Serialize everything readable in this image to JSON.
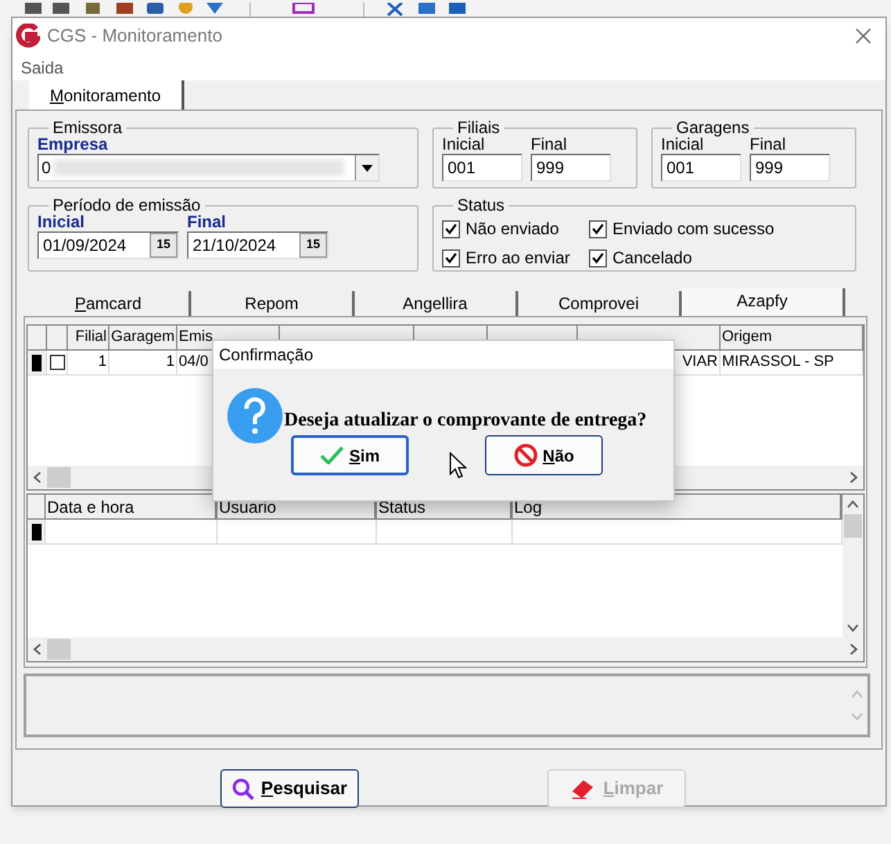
{
  "window": {
    "title": "CGS - Monitoramento"
  },
  "menu": [
    "Saida"
  ],
  "main_tabs": [
    {
      "label": "Monitoramento",
      "selected": true,
      "mnemonic": true
    }
  ],
  "emissora": {
    "title": "Emissora",
    "empresa_label": "Empresa",
    "empresa_value": "0"
  },
  "filiais": {
    "title": "Filiais",
    "inicial_label": "Inicial",
    "inicial": "001",
    "final_label": "Final",
    "final": "999"
  },
  "garagens": {
    "title": "Garagens",
    "inicial_label": "Inicial",
    "inicial": "001",
    "final_label": "Final",
    "final": "999"
  },
  "periodo": {
    "title": "Período de emissão",
    "inicial_label": "Inicial",
    "inicial": "01/09/2024",
    "final_label": "Final",
    "final": "21/10/2024",
    "inicial_calendar": "15",
    "final_calendar": "15"
  },
  "status": {
    "title": "Status",
    "options": [
      {
        "label": "Não enviado",
        "checked": true
      },
      {
        "label": "Enviado com sucesso",
        "checked": true
      },
      {
        "label": "Erro ao enviar",
        "checked": true
      },
      {
        "label": "Cancelado",
        "checked": true
      }
    ]
  },
  "provider_tabs": [
    {
      "label": "Pamcard",
      "selected": false,
      "mnemonic": true
    },
    {
      "label": "Repom",
      "selected": false,
      "mnemonic": false
    },
    {
      "label": "Angellira",
      "selected": false,
      "mnemonic": false
    },
    {
      "label": "Comprovei",
      "selected": false,
      "mnemonic": false
    },
    {
      "label": "Azapfy",
      "selected": true,
      "mnemonic": false
    }
  ],
  "grid": {
    "columns_left": [
      "Filial",
      "Garagem",
      "Emis"
    ],
    "column_right": "Origem",
    "rows": [
      {
        "current": true,
        "checked": false,
        "cells": [
          "1",
          "1",
          "04/0"
        ],
        "status": "VIAR",
        "origem": "MIRASSOL - SP"
      }
    ]
  },
  "log_grid": {
    "columns": [
      "Data e hora",
      "Usuario",
      "Status",
      "Log"
    ]
  },
  "dialog": {
    "title": "Confirmação",
    "message": "Deseja atualizar o comprovante de entrega?",
    "buttons": [
      {
        "label": "Sim",
        "kind": "yes",
        "default": true
      },
      {
        "label": "Não",
        "kind": "no",
        "default": false
      }
    ]
  },
  "buttons": [
    {
      "label": "Pesquisar",
      "kind": "search",
      "disabled": false
    },
    {
      "label": "Limpar",
      "kind": "clear",
      "disabled": true
    }
  ]
}
